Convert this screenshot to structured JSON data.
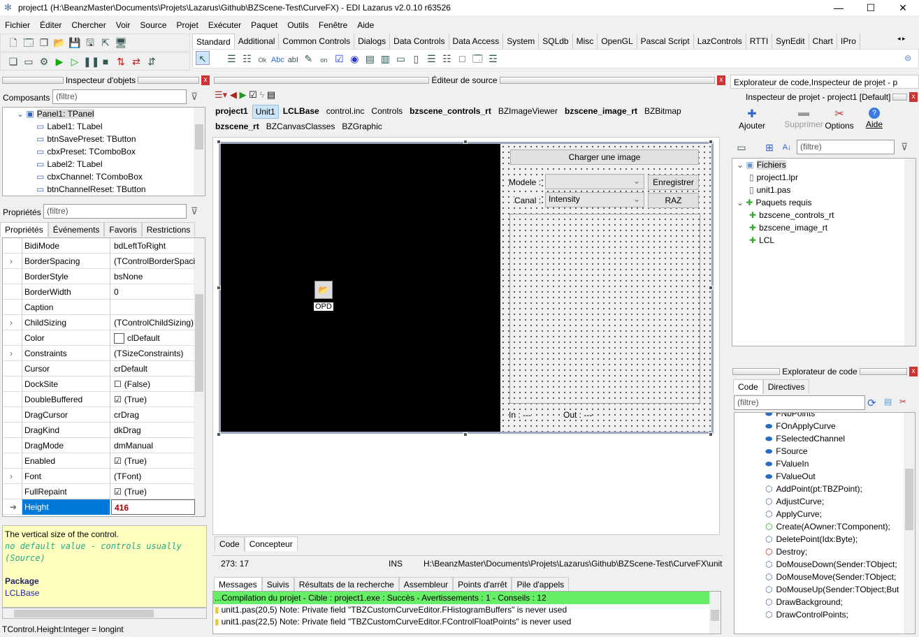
{
  "title": "project1 (H:\\BeanzMaster\\Documents\\Projets\\Lazarus\\Github\\BZScene-Test\\CurveFX) - EDI Lazarus v2.0.10 r63526",
  "menu": [
    "Fichier",
    "Éditer",
    "Chercher",
    "Voir",
    "Source",
    "Projet",
    "Exécuter",
    "Paquet",
    "Outils",
    "Fenêtre",
    "Aide"
  ],
  "palette": {
    "tabs": [
      "Standard",
      "Additional",
      "Common Controls",
      "Dialogs",
      "Data Controls",
      "Data Access",
      "System",
      "SQLdb",
      "Misc",
      "OpenGL",
      "Pascal Script",
      "LazControls",
      "RTTI",
      "SynEdit",
      "Chart",
      "IPro"
    ],
    "active": "Standard"
  },
  "object_inspector": {
    "title": "Inspecteur d'objets",
    "components_label": "Composants",
    "filter_placeholder": "(filtre)",
    "tree": [
      "Panel1: TPanel",
      "Label1: TLabel",
      "btnSavePreset: TButton",
      "cbxPreset: TComboBox",
      "Label2: TLabel",
      "cbxChannel: TComboBox",
      "btnChannelReset: TButton"
    ],
    "properties_label": "Propriétés",
    "tabs": [
      "Propriétés",
      "Événements",
      "Favoris",
      "Restrictions"
    ],
    "props": [
      {
        "name": "BidiMode",
        "value": "bdLeftToRight"
      },
      {
        "name": "BorderSpacing",
        "value": "(TControlBorderSpacing)",
        "expand": true
      },
      {
        "name": "BorderStyle",
        "value": "bsNone"
      },
      {
        "name": "BorderWidth",
        "value": "0"
      },
      {
        "name": "Caption",
        "value": ""
      },
      {
        "name": "ChildSizing",
        "value": "(TControlChildSizing)",
        "expand": true
      },
      {
        "name": "Color",
        "value": "clDefault",
        "swatch": true
      },
      {
        "name": "Constraints",
        "value": "(TSizeConstraints)",
        "expand": true
      },
      {
        "name": "Cursor",
        "value": "crDefault"
      },
      {
        "name": "DockSite",
        "value": "(False)",
        "check": false
      },
      {
        "name": "DoubleBuffered",
        "value": "(True)",
        "check": true
      },
      {
        "name": "DragCursor",
        "value": "crDrag"
      },
      {
        "name": "DragKind",
        "value": "dkDrag"
      },
      {
        "name": "DragMode",
        "value": "dmManual"
      },
      {
        "name": "Enabled",
        "value": "(True)",
        "check": true
      },
      {
        "name": "Font",
        "value": "(TFont)",
        "expand": true
      },
      {
        "name": "FullRepaint",
        "value": "(True)",
        "check": true
      },
      {
        "name": "Height",
        "value": "416",
        "selected": true
      }
    ],
    "help": {
      "line1": "The vertical size of the control.",
      "line2": "no default value - controls usually",
      "line3": "(Source)",
      "package_label": "Package",
      "package": "LCLBase"
    },
    "status": "TControl.Height:Integer = longint"
  },
  "editor": {
    "title": "Éditeur de source",
    "unit_tabs_row1": [
      {
        "t": "project1",
        "b": true
      },
      {
        "t": "Unit1",
        "a": true
      },
      {
        "t": "LCLBase",
        "b": true
      },
      {
        "t": "control.inc"
      },
      {
        "t": "Controls"
      },
      {
        "t": "bzscene_controls_rt",
        "b": true
      },
      {
        "t": "BZImageViewer"
      },
      {
        "t": "bzscene_image_rt",
        "b": true
      },
      {
        "t": "BZBitmap"
      }
    ],
    "unit_tabs_row2": [
      {
        "t": "bzscene_rt",
        "b": true
      },
      {
        "t": "BZCanvasClasses"
      },
      {
        "t": "BZGraphic"
      }
    ],
    "form": {
      "opd_label": "OPD",
      "load_button": "Charger une image",
      "model_label": "Modele :",
      "model_value": "",
      "save_button": "Enregistrer",
      "channel_label": "Canal :",
      "channel_value": "Intensity",
      "reset_button": "RAZ",
      "in_label": "In : ---",
      "out_label": "Out : ---"
    },
    "bottom_tabs": [
      "Code",
      "Concepteur"
    ],
    "status": {
      "pos": "273:  17",
      "mode": "INS",
      "path": "H:\\BeanzMaster\\Documents\\Projets\\Lazarus\\Github\\BZScene-Test\\CurveFX\\unit"
    }
  },
  "messages": {
    "tabs": [
      "Messages",
      "Suivis",
      "Résultats de la recherche",
      "Assembleur",
      "Points d'arrêt",
      "Pile d'appels"
    ],
    "summary": "...Compilation du projet - Cible : project1.exe : Succès - Avertissements : 1 - Conseils : 12",
    "items": [
      "unit1.pas(20,5) Note: Private field \"TBZCustomCurveEditor.FHistogramBuffers\" is never used",
      "unit1.pas(22,5) Note: Private field \"TBZCustomCurveEditor.FControlFloatPoints\" is never used"
    ],
    "summary_color": "#66ee66"
  },
  "project_inspector": {
    "dock_title": "Explorateur de code,Inspecteur de projet - p",
    "title": "Inspecteur de projet - project1 [Default]",
    "buttons": {
      "add": "Ajouter",
      "remove": "Supprimer",
      "options": "Options",
      "help": "Aide"
    },
    "filter_placeholder": "(filtre)",
    "tree": [
      {
        "t": "Fichiers",
        "l": 0,
        "i": "folder"
      },
      {
        "t": "project1.lpr",
        "l": 1,
        "i": "file"
      },
      {
        "t": "unit1.pas",
        "l": 1,
        "i": "file"
      },
      {
        "t": "Paquets requis",
        "l": 0,
        "i": "package"
      },
      {
        "t": "bzscene_controls_rt",
        "l": 1,
        "i": "package"
      },
      {
        "t": "bzscene_image_rt",
        "l": 1,
        "i": "package"
      },
      {
        "t": "LCL",
        "l": 1,
        "i": "package"
      }
    ]
  },
  "code_explorer": {
    "title": "Explorateur de code",
    "tabs": [
      "Code",
      "Directives"
    ],
    "filter_placeholder": "(filtre)",
    "items": [
      {
        "t": "FNbPoints",
        "k": "field"
      },
      {
        "t": "FOnApplyCurve",
        "k": "field"
      },
      {
        "t": "FSelectedChannel",
        "k": "field"
      },
      {
        "t": "FSource",
        "k": "field"
      },
      {
        "t": "FValueIn",
        "k": "field"
      },
      {
        "t": "FValueOut",
        "k": "field"
      },
      {
        "t": "AddPoint(pt:TBZPoint);",
        "k": "method"
      },
      {
        "t": "AdjustCurve;",
        "k": "method"
      },
      {
        "t": "ApplyCurve;",
        "k": "method"
      },
      {
        "t": "Create(AOwner:TComponent);",
        "k": "ctor"
      },
      {
        "t": "DeletePoint(Idx:Byte);",
        "k": "method"
      },
      {
        "t": "Destroy;",
        "k": "dtor"
      },
      {
        "t": "DoMouseDown(Sender:TObject;",
        "k": "method"
      },
      {
        "t": "DoMouseMove(Sender:TObject;",
        "k": "method"
      },
      {
        "t": "DoMouseUp(Sender:TObject;But",
        "k": "method"
      },
      {
        "t": "DrawBackground;",
        "k": "method"
      },
      {
        "t": "DrawControlPoints;",
        "k": "method"
      }
    ]
  }
}
